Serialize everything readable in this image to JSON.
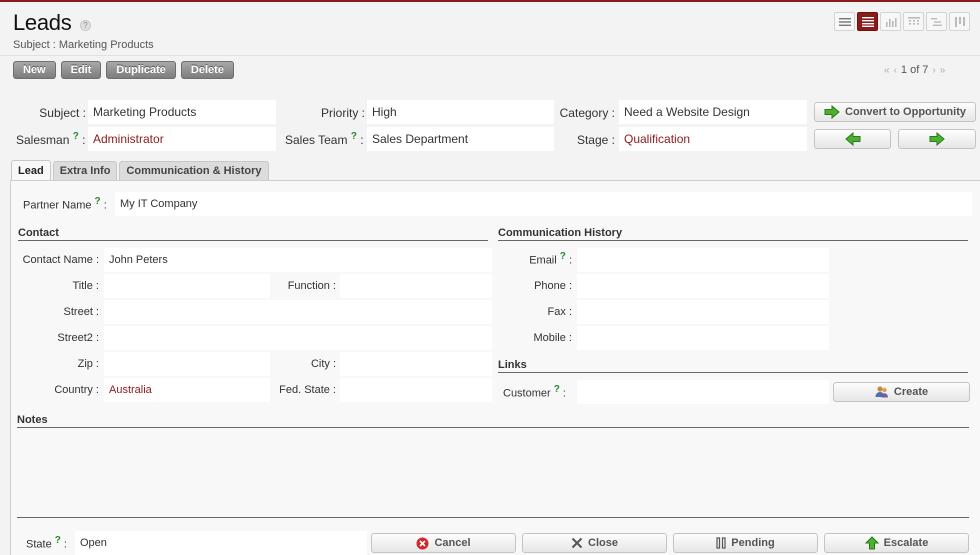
{
  "header": {
    "title": "Leads",
    "help_glyph": "?",
    "subtitle": "Subject : Marketing Products"
  },
  "views": [
    {
      "name": "list-view",
      "icon": "list-icon"
    },
    {
      "name": "form-view",
      "icon": "form-icon",
      "active": true
    },
    {
      "name": "graph-view",
      "icon": "bar-chart-icon"
    },
    {
      "name": "calendar-view",
      "icon": "calendar-icon"
    },
    {
      "name": "gantt-view",
      "icon": "gantt-icon"
    },
    {
      "name": "kanban-view",
      "icon": "kanban-icon"
    }
  ],
  "actions": {
    "new": "New",
    "edit": "Edit",
    "duplicate": "Duplicate",
    "delete": "Delete"
  },
  "pager": {
    "first": "«",
    "prev": "‹",
    "text": "1 of 7",
    "next": "›",
    "last": "»"
  },
  "form": {
    "subject_label": "Subject :",
    "subject": "Marketing Products",
    "priority_label": "Priority :",
    "priority": "High",
    "category_label": "Category :",
    "category": "Need a Website Design",
    "salesman_label": "Salesman",
    "salesman": "Administrator",
    "sales_team_label": "Sales Team",
    "sales_team": "Sales Department",
    "stage_label": "Stage :",
    "stage": "Qualification",
    "convert_button": "Convert to Opportunity",
    "help_mark": "?",
    "colon": ":"
  },
  "tabs": [
    {
      "label": "Lead",
      "active": true
    },
    {
      "label": "Extra Info"
    },
    {
      "label": "Communication & History"
    }
  ],
  "lead": {
    "partner_name_label": "Partner Name",
    "partner_name": "My IT Company",
    "contact_section": "Contact",
    "contact_name_label": "Contact Name :",
    "contact_name": "John Peters",
    "title_label": "Title :",
    "title": "",
    "function_label": "Function :",
    "function": "",
    "street_label": "Street :",
    "street": "",
    "street2_label": "Street2 :",
    "street2": "",
    "zip_label": "Zip :",
    "zip": "",
    "city_label": "City :",
    "city": "",
    "country_label": "Country :",
    "country": "Australia",
    "fed_state_label": "Fed. State :",
    "fed_state": "",
    "comm_section": "Communication History",
    "email_label": "Email",
    "email": "",
    "phone_label": "Phone :",
    "phone": "",
    "fax_label": "Fax :",
    "fax": "",
    "mobile_label": "Mobile :",
    "mobile": "",
    "links_section": "Links",
    "customer_label": "Customer",
    "customer": "",
    "create_button": "Create",
    "notes_section": "Notes"
  },
  "footer": {
    "state_label": "State",
    "state": "Open",
    "cancel": "Cancel",
    "close": "Close",
    "pending": "Pending",
    "escalate": "Escalate"
  },
  "colors": {
    "accent": "#8b1a1a",
    "help_green": "#2a8a2a",
    "arrow_green": "#3aa82a"
  }
}
